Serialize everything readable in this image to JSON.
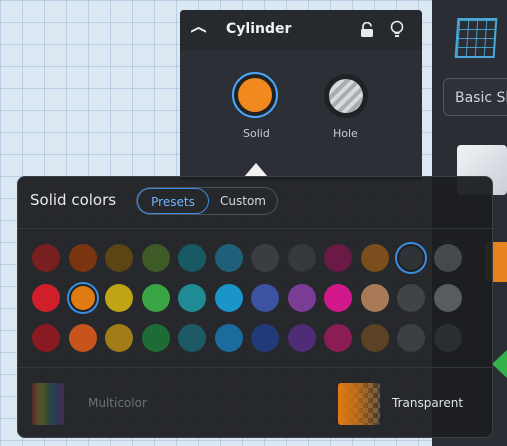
{
  "inspector": {
    "title": "Cylinder",
    "solid_label": "Solid",
    "hole_label": "Hole"
  },
  "right_panel": {
    "dropdown_label": "Basic Sh"
  },
  "color_popup": {
    "title": "Solid colors",
    "tabs": [
      {
        "label": "Presets",
        "active": true
      },
      {
        "label": "Custom",
        "active": false
      }
    ],
    "swatch_rows": [
      [
        "#7a1f1f",
        "#7b3410",
        "#5b4512",
        "#3e5a25",
        "#175a63",
        "#1f5f7a",
        "#3a3d42",
        "#35383d",
        "#6a1a44",
        "#7b4e1d",
        "#2f3237",
        "#45484d"
      ],
      [
        "#d01f2b",
        "#e07a12",
        "#bfa514",
        "#3aa545",
        "#1f8b94",
        "#1a94c9",
        "#3c53a1",
        "#7a3d96",
        "#d0188a",
        "#a87a58",
        "#404347",
        "#585b60"
      ],
      [
        "#8a1a22",
        "#c8541d",
        "#a27d17",
        "#1e6b35",
        "#1e5a66",
        "#1a6c9c",
        "#233a78",
        "#4e2c76",
        "#8a1d55",
        "#5b4225",
        "#3c3f44",
        "#2a2d31"
      ]
    ],
    "selected": [
      {
        "row": 0,
        "col": 10
      },
      {
        "row": 1,
        "col": 1
      }
    ],
    "multicolor_label": "Multicolor",
    "transparent_label": "Transparent"
  }
}
